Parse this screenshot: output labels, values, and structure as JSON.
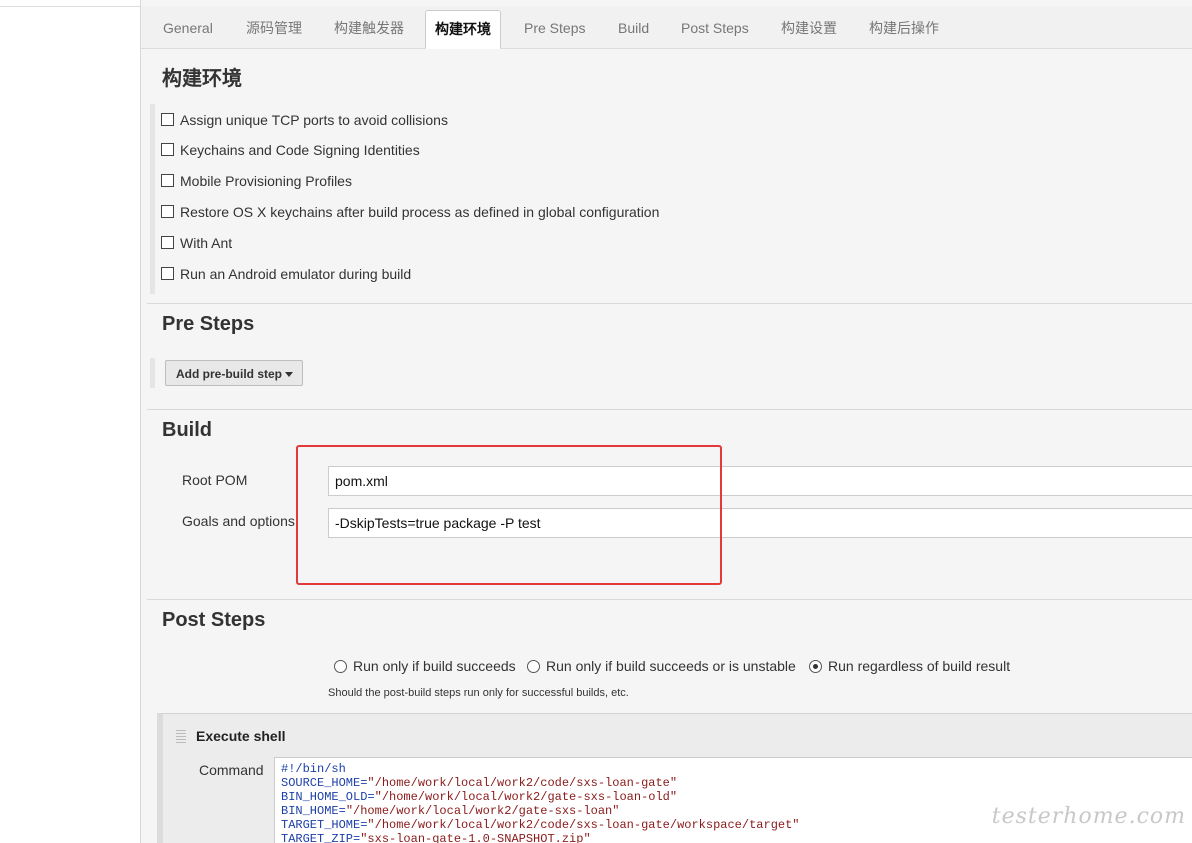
{
  "tabs": [
    "General",
    "源码管理",
    "构建触发器",
    "构建环境",
    "Pre Steps",
    "Build",
    "Post Steps",
    "构建设置",
    "构建后操作"
  ],
  "active_tab": "构建环境",
  "build_env": {
    "title": "构建环境",
    "options": [
      "Assign unique TCP ports to avoid collisions",
      "Keychains and Code Signing Identities",
      "Mobile Provisioning Profiles",
      "Restore OS X keychains after build process as defined in global configuration",
      "With Ant",
      "Run an Android emulator during build"
    ]
  },
  "pre_steps": {
    "title": "Pre Steps",
    "add_button": "Add pre-build step"
  },
  "build": {
    "title": "Build",
    "root_pom_label": "Root POM",
    "root_pom_value": "pom.xml",
    "goals_label": "Goals and options",
    "goals_value": "-DskipTests=true package -P test"
  },
  "post_steps": {
    "title": "Post Steps",
    "radios": [
      "Run only if build succeeds",
      "Run only if build succeeds or is unstable",
      "Run regardless of build result"
    ],
    "selected_index": 2,
    "help": "Should the post-build steps run only for successful builds, etc."
  },
  "execute_shell": {
    "title": "Execute shell",
    "command_label": "Command",
    "lines": [
      {
        "k": "#!/bin/sh",
        "v": ""
      },
      {
        "k": "SOURCE_HOME=",
        "v": "\"/home/work/local/work2/code/sxs-loan-gate\""
      },
      {
        "k": "BIN_HOME_OLD=",
        "v": "\"/home/work/local/work2/gate-sxs-loan-old\""
      },
      {
        "k": "BIN_HOME=",
        "v": "\"/home/work/local/work2/gate-sxs-loan\""
      },
      {
        "k": "TARGET_HOME=",
        "v": "\"/home/work/local/work2/code/sxs-loan-gate/workspace/target\""
      },
      {
        "k": "TARGET_ZIP=",
        "v": "\"sxs-loan-gate-1.0-SNAPSHOT.zip\""
      }
    ]
  },
  "watermark": "testerhome.com"
}
